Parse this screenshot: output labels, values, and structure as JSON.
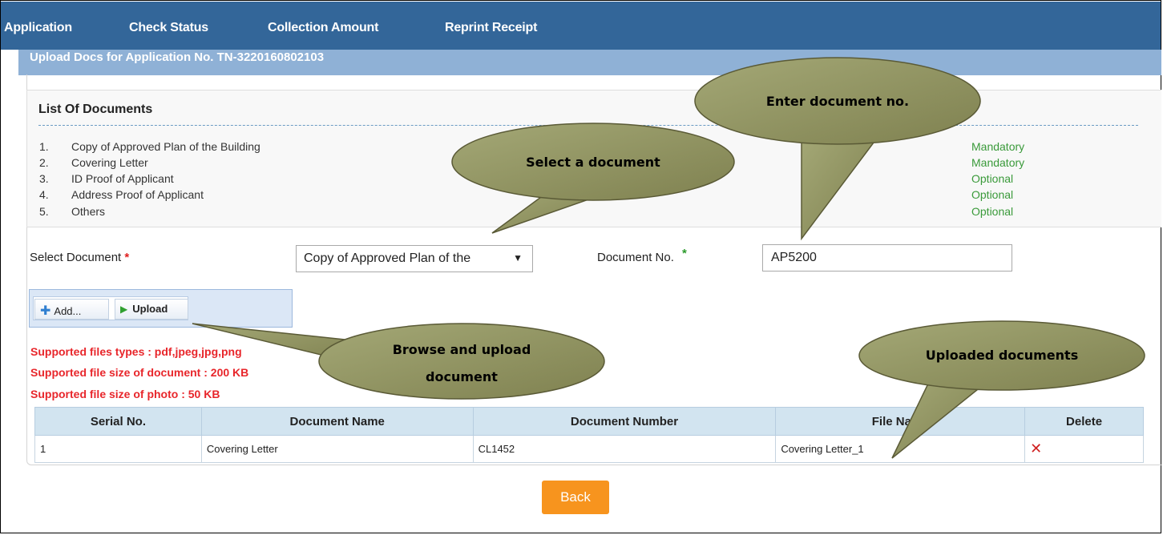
{
  "nav": {
    "items": [
      "Application",
      "Check Status",
      "Collection Amount",
      "Reprint Receipt"
    ]
  },
  "subheader": {
    "title": "Upload Docs for Application No. TN-3220160802103"
  },
  "documents": {
    "title": "List Of Documents",
    "items": [
      {
        "num": "1.",
        "name": "Copy of Approved Plan of the Building",
        "req": "Mandatory"
      },
      {
        "num": "2.",
        "name": "Covering Letter",
        "req": "Mandatory"
      },
      {
        "num": "3.",
        "name": "ID Proof of Applicant",
        "req": "Optional"
      },
      {
        "num": "4.",
        "name": "Address Proof of Applicant",
        "req": "Optional"
      },
      {
        "num": "5.",
        "name": "Others",
        "req": "Optional"
      }
    ]
  },
  "form": {
    "select_label": "Select Document",
    "select_value": "Copy of Approved Plan of the",
    "docno_label": "Document No.",
    "docno_value": "AP5200",
    "required_star": "*"
  },
  "upload": {
    "add_label": "Add...",
    "upload_label": "Upload"
  },
  "notes": [
    "Supported files types : pdf,jpeg,jpg,png",
    "Supported file size of document : 200 KB",
    "Supported file size of photo : 50 KB"
  ],
  "table": {
    "headers": [
      "Serial No.",
      "Document Name",
      "Document Number",
      "File Name",
      "Delete"
    ],
    "rows": [
      {
        "serial": "1",
        "name": "Covering Letter",
        "number": "CL1452",
        "file": "Covering Letter_1",
        "delete": "✕"
      }
    ]
  },
  "back_label": "Back",
  "callouts": {
    "enter_doc_no": "Enter document no.",
    "select_doc": "Select a document",
    "browse_upload_1": "Browse and upload",
    "browse_upload_2": "document",
    "uploaded_docs": "Uploaded documents"
  },
  "colors": {
    "nav_bg": "#336699",
    "subheader_bg": "#8fb1d6",
    "note_red": "#e8262b",
    "mandatory_green": "#3a9a3a",
    "back_orange": "#f7941e",
    "callout_fill": "#8e8e5e"
  }
}
